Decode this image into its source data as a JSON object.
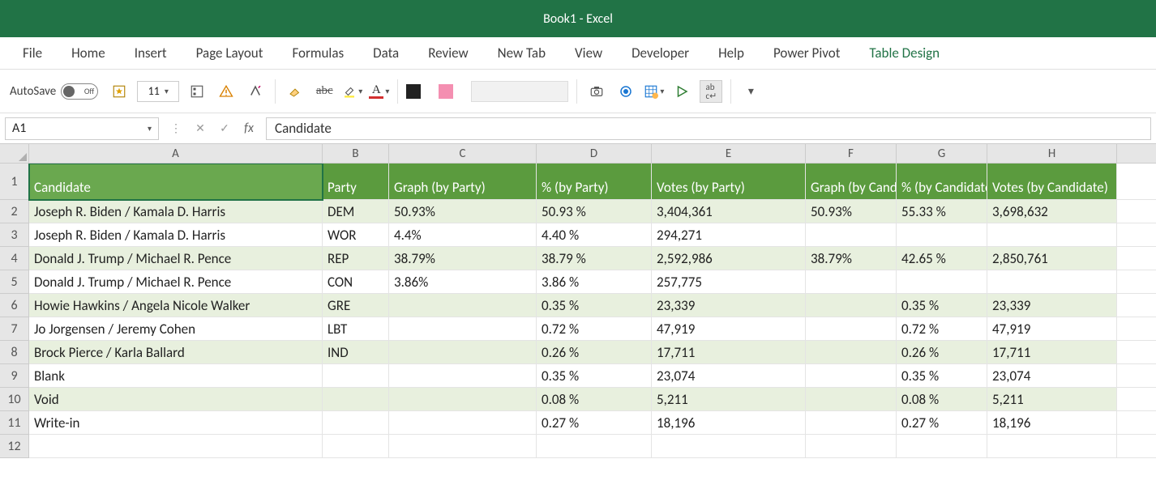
{
  "titlebar": {
    "title": "Book1  -  Excel"
  },
  "ribbon": {
    "tabs": [
      "File",
      "Home",
      "Insert",
      "Page Layout",
      "Formulas",
      "Data",
      "Review",
      "New Tab",
      "View",
      "Developer",
      "Help",
      "Power Pivot",
      "Table Design"
    ]
  },
  "toolbar": {
    "autosave_label": "AutoSave",
    "autosave_state": "Off",
    "font_size": "11"
  },
  "formulabar": {
    "namebox": "A1",
    "fx_label": "fx",
    "content": "Candidate"
  },
  "columns": [
    "A",
    "B",
    "C",
    "D",
    "E",
    "F",
    "G",
    "H"
  ],
  "column_widths": [
    "cA",
    "cB",
    "cC",
    "cD",
    "cE",
    "cF",
    "cG",
    "cH"
  ],
  "table": {
    "headers": [
      "Candidate",
      "Party",
      "Graph (by Party)",
      "% (by Party)",
      "Votes (by Party)",
      "Graph (by Candidate)",
      "% (by Candidate)",
      "Votes (by Candidate)"
    ],
    "rows": [
      [
        "Joseph R. Biden / Kamala D. Harris",
        "DEM",
        "50.93%",
        "50.93 %",
        "3,404,361",
        "50.93%",
        "55.33 %",
        "3,698,632"
      ],
      [
        "Joseph R. Biden / Kamala D. Harris",
        "WOR",
        "4.4%",
        "4.40 %",
        "294,271",
        "",
        "",
        ""
      ],
      [
        "Donald J. Trump / Michael R. Pence",
        "REP",
        "38.79%",
        "38.79 %",
        "2,592,986",
        "38.79%",
        "42.65 %",
        "2,850,761"
      ],
      [
        "Donald J. Trump / Michael R. Pence",
        "CON",
        "3.86%",
        "3.86 %",
        "257,775",
        "",
        "",
        ""
      ],
      [
        "Howie Hawkins / Angela Nicole Walker",
        "GRE",
        "",
        "0.35 %",
        "23,339",
        "",
        "0.35 %",
        "23,339"
      ],
      [
        "Jo Jorgensen / Jeremy Cohen",
        "LBT",
        "",
        "0.72 %",
        "47,919",
        "",
        "0.72 %",
        "47,919"
      ],
      [
        "Brock Pierce / Karla Ballard",
        "IND",
        "",
        "0.26 %",
        "17,711",
        "",
        "0.26 %",
        "17,711"
      ],
      [
        "Blank",
        "",
        "",
        "0.35 %",
        "23,074",
        "",
        "0.35 %",
        "23,074"
      ],
      [
        "Void",
        "",
        "",
        "0.08 %",
        "5,211",
        "",
        "0.08 %",
        "5,211"
      ],
      [
        "Write-in",
        "",
        "",
        "0.27 %",
        "18,196",
        "",
        "0.27 %",
        "18,196"
      ]
    ]
  },
  "extra_row_count": 1
}
